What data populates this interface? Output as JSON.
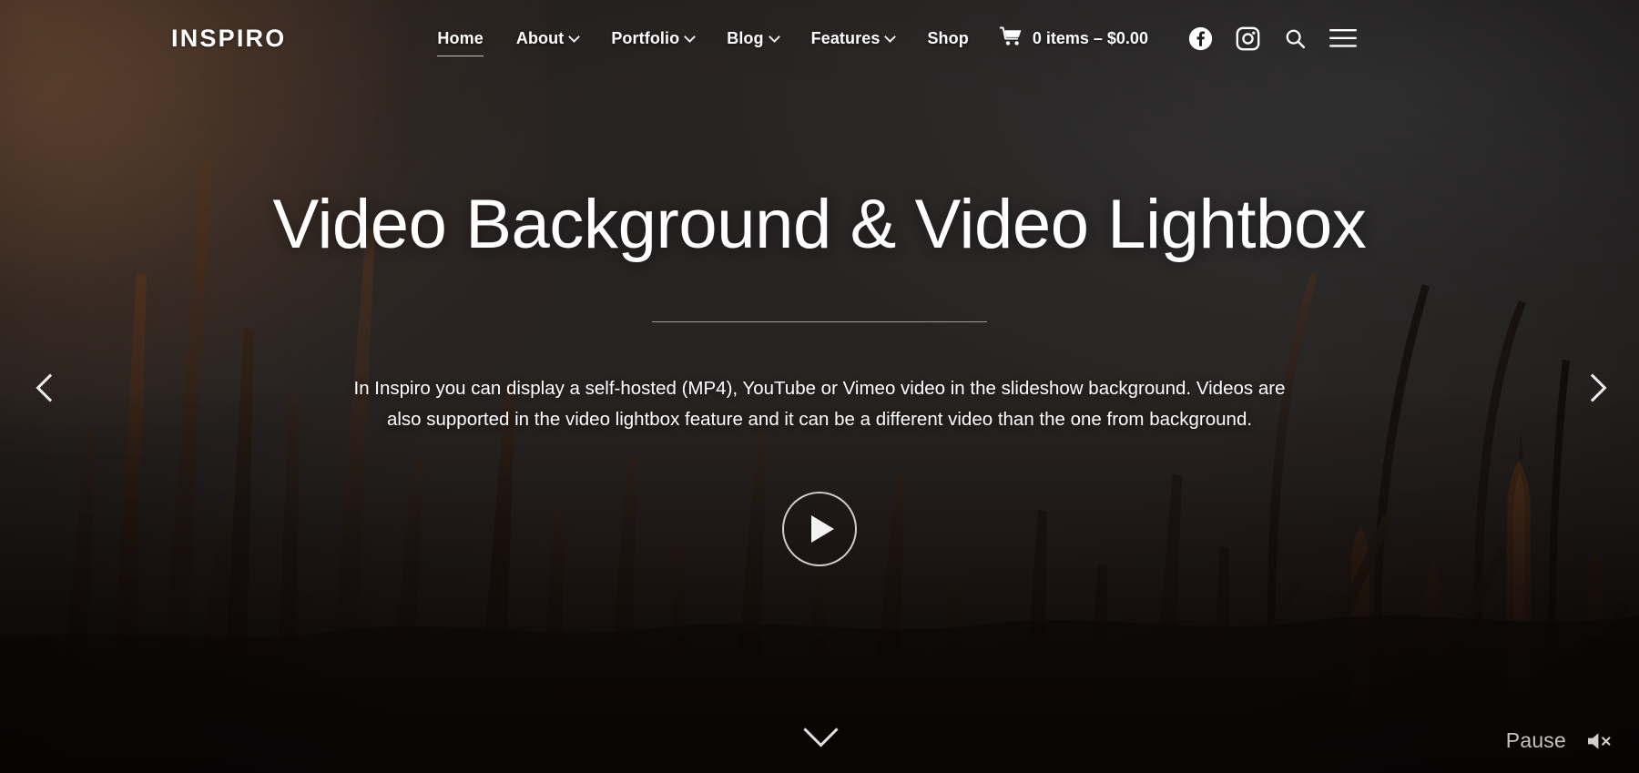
{
  "site": {
    "logo": "INSPIRO"
  },
  "nav": {
    "items": [
      {
        "label": "Home",
        "has_caret": false,
        "active": true
      },
      {
        "label": "About",
        "has_caret": true,
        "active": false
      },
      {
        "label": "Portfolio",
        "has_caret": true,
        "active": false
      },
      {
        "label": "Blog",
        "has_caret": true,
        "active": false
      },
      {
        "label": "Features",
        "has_caret": true,
        "active": false
      },
      {
        "label": "Shop",
        "has_caret": false,
        "active": false
      }
    ],
    "cart": {
      "icon": "shopping-cart-icon",
      "label": "0 items – $0.00",
      "count": 0,
      "total": "$0.00"
    },
    "icons": [
      {
        "name": "facebook-icon"
      },
      {
        "name": "instagram-icon"
      },
      {
        "name": "search-icon"
      },
      {
        "name": "hamburger-menu-icon"
      }
    ]
  },
  "hero": {
    "title": "Video Background & Video Lightbox",
    "paragraph": "In Inspiro you can display a self-hosted (MP4), YouTube or Vimeo video in the slideshow background. Videos are also supported in the video lightbox feature and it can be a different video than the one from background.",
    "play_button": "play-button",
    "prev_arrow": "previous-slide-arrow",
    "next_arrow": "next-slide-arrow",
    "scroll_down": "scroll-down-arrow"
  },
  "media_controls": {
    "pause_label": "Pause",
    "mute_icon": "muted-speaker-icon"
  },
  "colors": {
    "text": "#ffffff",
    "muted_text": "#d6d3d0",
    "sky_top": "#3a3836",
    "warm_glow": "#ad744a",
    "bottom_dark": "#0d0907"
  }
}
